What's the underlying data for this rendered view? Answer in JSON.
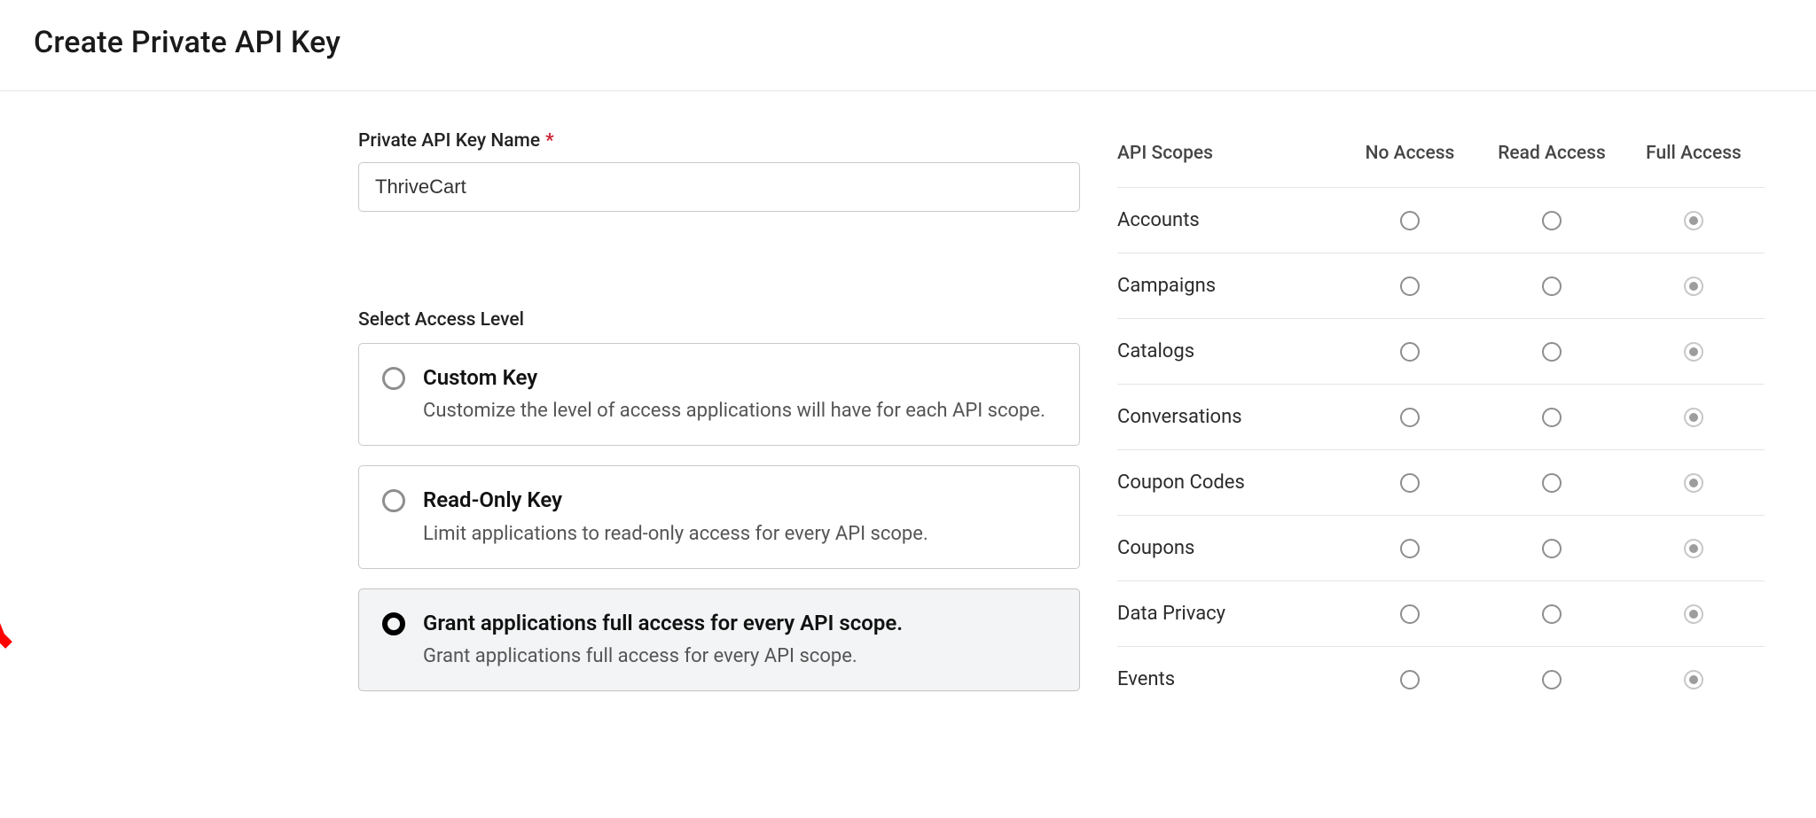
{
  "page_title": "Create Private API Key",
  "name_field": {
    "label": "Private API Key Name",
    "value": "ThriveCart"
  },
  "access_level": {
    "label": "Select Access Level",
    "options": [
      {
        "title": "Custom Key",
        "desc": "Customize the level of access applications will have for each API scope.",
        "selected": false
      },
      {
        "title": "Read-Only Key",
        "desc": "Limit applications to read-only access for every API scope.",
        "selected": false
      },
      {
        "title": "Grant applications full access for every API scope.",
        "desc": "Grant applications full access for every API scope.",
        "selected": true
      }
    ]
  },
  "scopes": {
    "header": {
      "scope": "API Scopes",
      "none": "No Access",
      "read": "Read Access",
      "full": "Full Access"
    },
    "rows": [
      {
        "name": "Accounts",
        "sel": "full"
      },
      {
        "name": "Campaigns",
        "sel": "full"
      },
      {
        "name": "Catalogs",
        "sel": "full"
      },
      {
        "name": "Conversations",
        "sel": "full"
      },
      {
        "name": "Coupon Codes",
        "sel": "full"
      },
      {
        "name": "Coupons",
        "sel": "full"
      },
      {
        "name": "Data Privacy",
        "sel": "full"
      },
      {
        "name": "Events",
        "sel": "full"
      }
    ]
  }
}
